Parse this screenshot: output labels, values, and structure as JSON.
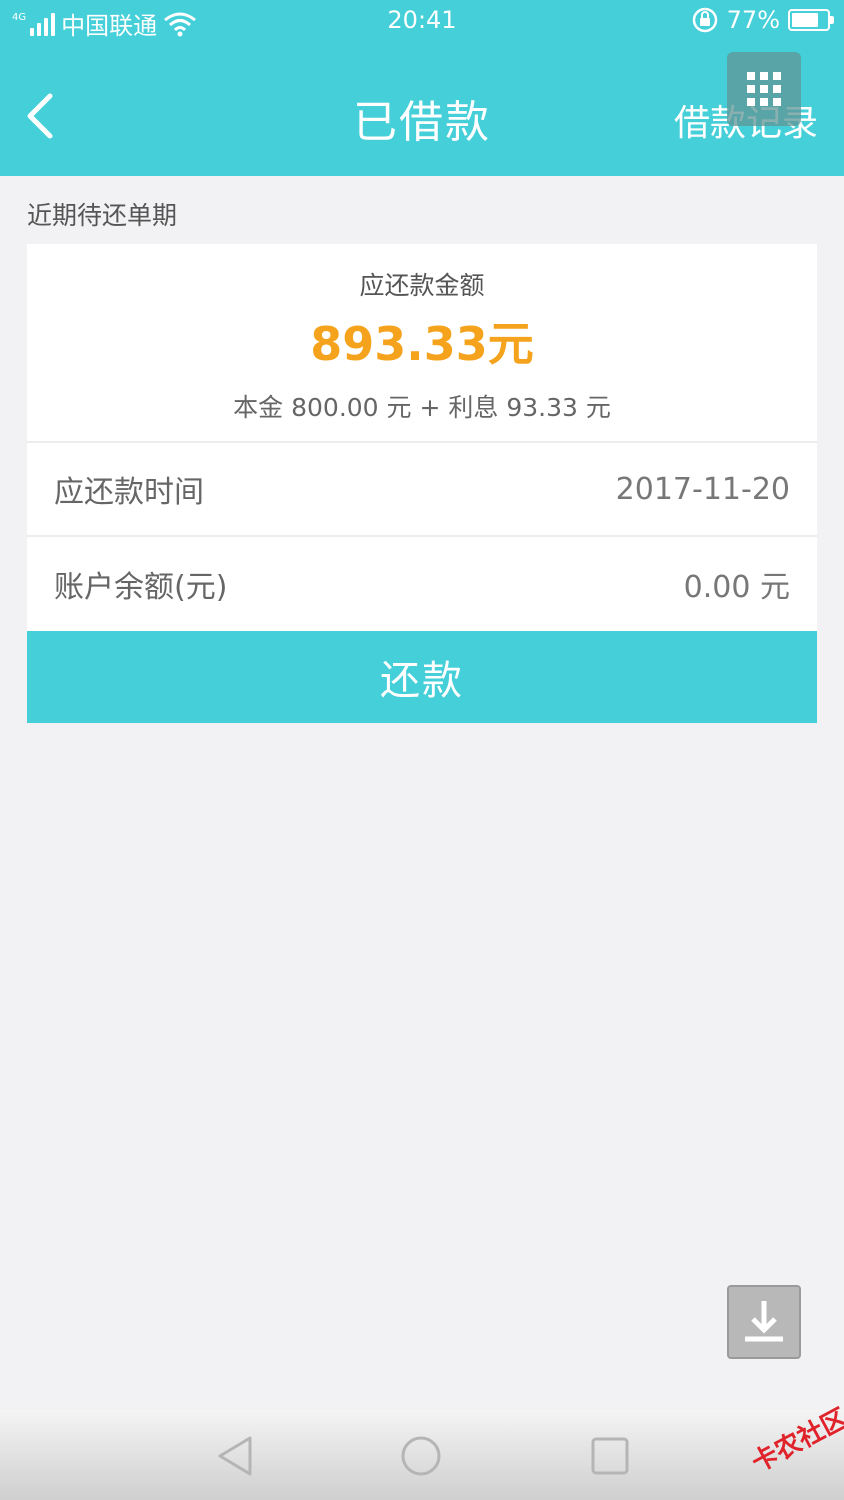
{
  "status_bar": {
    "network": "4G",
    "carrier": "中国联通",
    "time": "20:41",
    "battery": "77%",
    "battery_level": 0.77
  },
  "header": {
    "title": "已借款",
    "records_link": "借款记录"
  },
  "section": {
    "label": "近期待还单期"
  },
  "summary": {
    "amount_label": "应还款金额",
    "amount_value": "893.33元",
    "amount_detail": "本金 800.00 元 + 利息 93.33 元"
  },
  "rows": [
    {
      "label": "应还款时间",
      "value": "2017-11-20"
    },
    {
      "label": "账户余额(元)",
      "value": "0.00 元"
    }
  ],
  "repay_button": "还款",
  "watermark": "卡农社区",
  "colors": {
    "accent": "#44cfd9",
    "amount": "#f5a31d",
    "background": "#f2f2f4"
  },
  "icons": [
    "back-arrow-icon",
    "wifi-icon",
    "lock-rotation-icon",
    "grid-menu-icon",
    "download-icon",
    "nav-back-icon",
    "nav-home-icon",
    "nav-recent-icon"
  ]
}
